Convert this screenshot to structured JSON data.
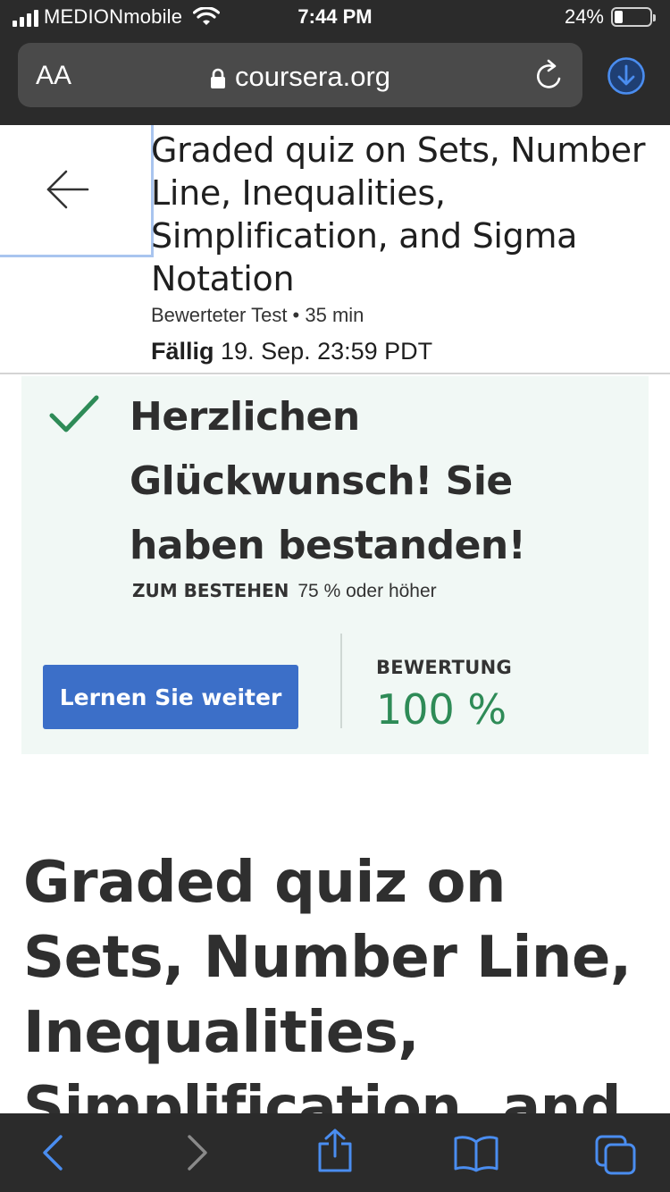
{
  "status_bar": {
    "carrier": "MEDIONmobile",
    "time": "7:44 PM",
    "battery": "24%",
    "battery_level": 0.24
  },
  "browser": {
    "text_size_label": "AA",
    "url": "coursera.org",
    "icons": {
      "lock": "lock-icon",
      "reload": "reload-icon",
      "download": "download-icon"
    }
  },
  "header": {
    "title": "Graded quiz on Sets, Number Line, Inequalities, Simplification, and Sigma Notation",
    "meta": "Bewerteter Test • 35 min",
    "due_label": "Fällig",
    "due_value": "19. Sep. 23:59 PDT"
  },
  "result": {
    "message": "Herzlichen Glückwunsch! Sie haben bestanden!",
    "pass_label": "ZUM BESTEHEN",
    "pass_value": "75 % oder höher",
    "continue_button": "Lernen Sie weiter",
    "grade_label": "BEWERTUNG",
    "grade_value": "100 %"
  },
  "main": {
    "title": "Graded quiz on Sets, Number Line, Inequalities, Simplification, and"
  },
  "colors": {
    "accent_blue": "#3c6fc8",
    "success_green": "#2e8b57",
    "panel_bg": "#f1f8f5",
    "browser_chrome": "#2b2b2b",
    "toolbar_icon": "#4a8df0"
  },
  "toolbar": {
    "icons": [
      "back-icon",
      "forward-icon",
      "share-icon",
      "bookmarks-icon",
      "tabs-icon"
    ]
  }
}
